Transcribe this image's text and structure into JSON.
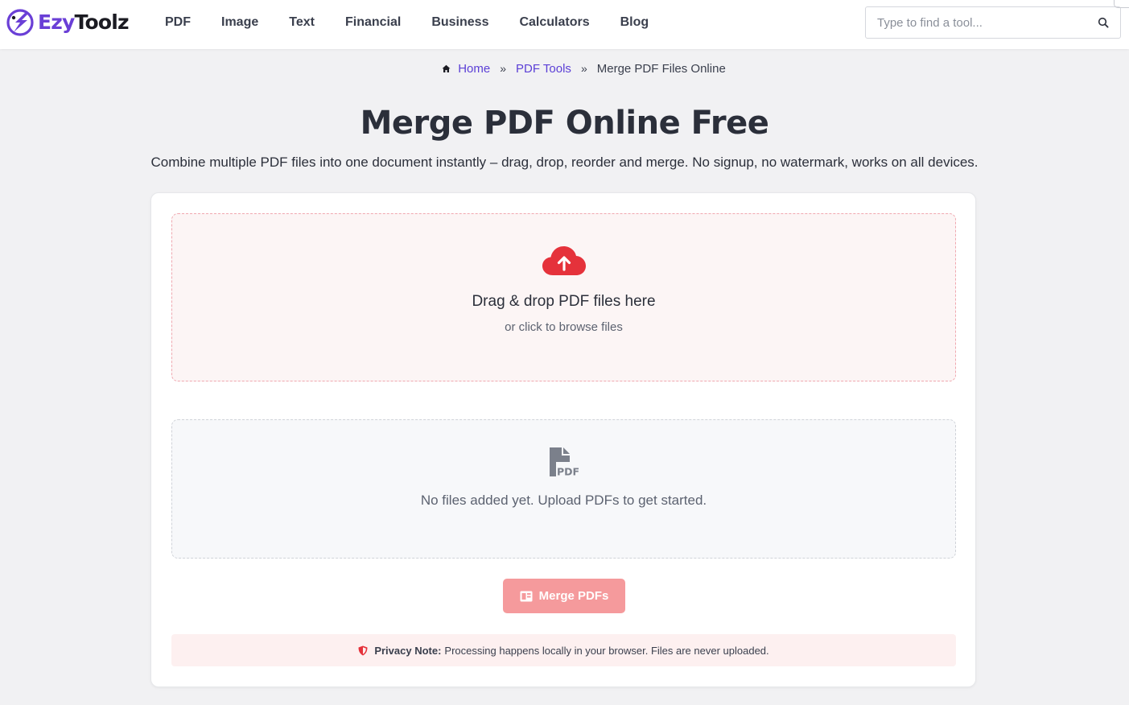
{
  "brand": {
    "name_part1": "Ezy",
    "name_part2": "Toolz",
    "accent": "#6a3fd6"
  },
  "nav": {
    "items": [
      {
        "label": "PDF"
      },
      {
        "label": "Image"
      },
      {
        "label": "Text"
      },
      {
        "label": "Financial"
      },
      {
        "label": "Business"
      },
      {
        "label": "Calculators"
      },
      {
        "label": "Blog"
      }
    ]
  },
  "search": {
    "placeholder": "Type to find a tool...",
    "value": "",
    "icon": "search-icon"
  },
  "breadcrumb": {
    "home_icon": "home-icon",
    "home": "Home",
    "separator": "»",
    "section": "PDF Tools",
    "current": "Merge PDF Files Online"
  },
  "page": {
    "title": "Merge PDF Online Free",
    "subtitle": "Combine multiple PDF files into one document instantly – drag, drop, reorder and merge. No signup, no watermark, works on all devices."
  },
  "dropzone": {
    "icon": "cloud-upload-icon",
    "title": "Drag & drop PDF files here",
    "subtitle": "or click to browse files",
    "accent": "#e5323b"
  },
  "file_list": {
    "icon": "pdf-file-icon",
    "empty_message": "No files added yet. Upload PDFs to get started."
  },
  "merge_button": {
    "label": "Merge PDFs",
    "icon": "merge-icon",
    "color": "#f59a9c"
  },
  "privacy": {
    "icon": "shield-icon",
    "label": "Privacy Note:",
    "text": "Processing happens locally in your browser. Files are never uploaded."
  }
}
